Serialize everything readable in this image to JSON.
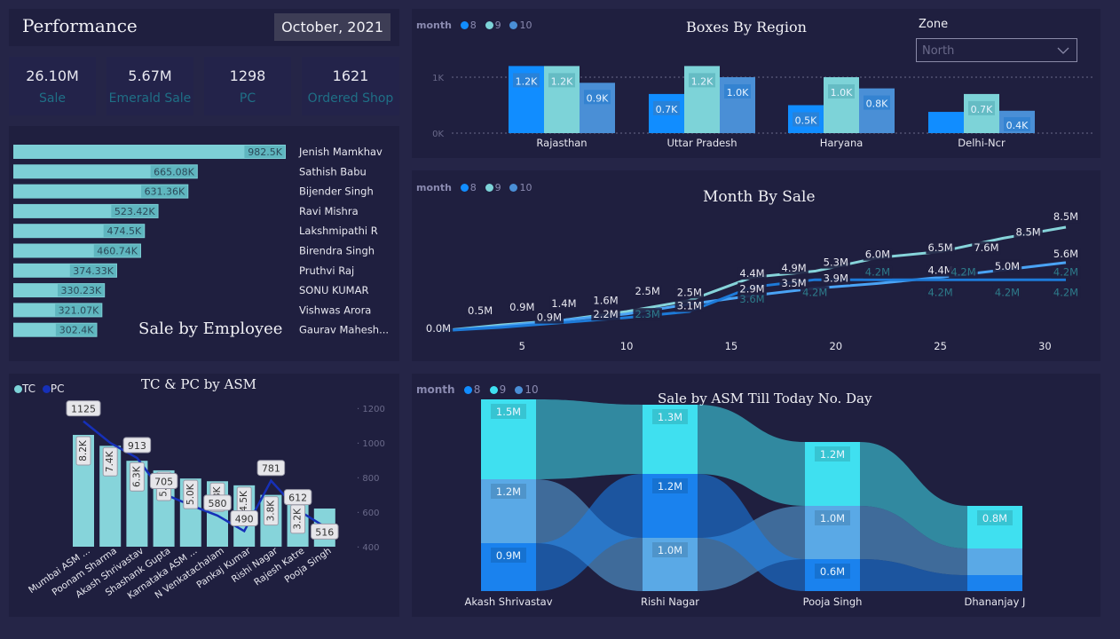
{
  "header": {
    "title": "Performance",
    "date": "October, 2021"
  },
  "kpis": [
    {
      "value": "26.10M",
      "label": "Sale"
    },
    {
      "value": "5.67M",
      "label": "Emerald Sale"
    },
    {
      "value": "1298",
      "label": "PC"
    },
    {
      "value": "1621",
      "label": "Ordered Shop"
    }
  ],
  "month_legend": {
    "label": "month",
    "items": [
      "8",
      "9",
      "10"
    ]
  },
  "zone": {
    "label": "Zone",
    "value": "North"
  },
  "colors": {
    "m8": "#118dff",
    "m9": "#7dd3d8",
    "m10": "#4a8fd6",
    "line8": "#4aa3f5",
    "line9": "#86d4da",
    "line10": "#1d7ad8"
  },
  "chart_data": [
    {
      "type": "bar",
      "title": "Sale by Employee",
      "orientation": "horizontal",
      "categories": [
        "Jenish Mamkhav",
        "Sathish Babu",
        "Bijender Singh",
        "Ravi Mishra",
        "Lakshmipathi R",
        "Birendra Singh",
        "Pruthvi Raj",
        "SONU KUMAR",
        "Vishwas Arora",
        "Gaurav Mahesh..."
      ],
      "values": [
        982500,
        665080,
        631360,
        523420,
        474500,
        460740,
        374330,
        330230,
        321070,
        302400
      ],
      "value_labels": [
        "982.5K",
        "665.08K",
        "631.36K",
        "523.42K",
        "474.5K",
        "460.74K",
        "374.33K",
        "330.23K",
        "321.07K",
        "302.4K"
      ]
    },
    {
      "type": "bar",
      "title": "Boxes By Region",
      "categories": [
        "Rajasthan",
        "Uttar Pradesh",
        "Haryana",
        "Delhi-Ncr"
      ],
      "ytick_labels": [
        "0K",
        "1K"
      ],
      "ylim": [
        0,
        1600
      ],
      "series": [
        {
          "name": "8",
          "values": [
            1200,
            700,
            500,
            380
          ],
          "labels": [
            "1.2K",
            "0.7K",
            "0.5K",
            ""
          ]
        },
        {
          "name": "9",
          "values": [
            1200,
            1200,
            1000,
            700
          ],
          "labels": [
            "1.2K",
            "1.2K",
            "1.0K",
            "0.7K"
          ]
        },
        {
          "name": "10",
          "values": [
            900,
            1000,
            800,
            400
          ],
          "labels": [
            "0.9K",
            "1.0K",
            "0.8K",
            "0.4K"
          ]
        }
      ]
    },
    {
      "type": "line",
      "title": "Month By Sale",
      "xticks": [
        5,
        10,
        15,
        20,
        25,
        30
      ],
      "xlim": [
        1,
        31
      ],
      "ylim": [
        0,
        9
      ],
      "series": [
        {
          "name": "9",
          "x": [
            1,
            4,
            7,
            10,
            13,
            16,
            19,
            22,
            25,
            28,
            31
          ],
          "values": [
            0.0,
            0.5,
            0.9,
            1.6,
            2.5,
            4.4,
            4.9,
            6.0,
            6.5,
            7.6,
            8.5
          ]
        },
        {
          "name": "8",
          "x": [
            1,
            4,
            7,
            10,
            13,
            16,
            19,
            22,
            25,
            28,
            31
          ],
          "values": [
            0.0,
            0.4,
            0.9,
            1.4,
            2.2,
            2.9,
            3.5,
            3.9,
            4.4,
            5.0,
            5.6
          ]
        },
        {
          "name": "10",
          "x": [
            1,
            4,
            7,
            10,
            13,
            16,
            19,
            22,
            25,
            28,
            31
          ],
          "values": [
            0.0,
            0.3,
            0.7,
            1.1,
            1.6,
            3.6,
            4.2,
            4.2,
            4.2,
            4.2,
            4.2
          ]
        }
      ],
      "data_labels": [
        {
          "text": "0.0M",
          "x": 1,
          "y": 0.0,
          "color": "#e8e8f0"
        },
        {
          "text": "0.5M",
          "x": 3,
          "y": 1.45,
          "color": "#e8e8f0"
        },
        {
          "text": "0.9M",
          "x": 5,
          "y": 1.75,
          "color": "#e8e8f0"
        },
        {
          "text": "1.4M",
          "x": 7,
          "y": 2.05,
          "color": "#e8e8f0"
        },
        {
          "text": "0.9M",
          "x": 6.3,
          "y": 0.9,
          "color": "#e8e8f0"
        },
        {
          "text": "1.6M",
          "x": 9,
          "y": 2.3,
          "color": "#e8e8f0"
        },
        {
          "text": "2.2M",
          "x": 9,
          "y": 1.15,
          "color": "#e8e8f0"
        },
        {
          "text": "2.3M",
          "x": 11,
          "y": 1.15,
          "color": "#2d7a8a"
        },
        {
          "text": "2.5M",
          "x": 11,
          "y": 3.05,
          "color": "#e8e8f0"
        },
        {
          "text": "2.5M",
          "x": 13,
          "y": 2.95,
          "color": "#e8e8f0"
        },
        {
          "text": "3.1M",
          "x": 13,
          "y": 1.85,
          "color": "#e8e8f0"
        },
        {
          "text": "4.4M",
          "x": 16,
          "y": 4.5,
          "color": "#e8e8f0"
        },
        {
          "text": "2.9M",
          "x": 16,
          "y": 3.25,
          "color": "#e8e8f0"
        },
        {
          "text": "3.6M",
          "x": 16,
          "y": 2.4,
          "color": "#2d7a8a"
        },
        {
          "text": "4.9M",
          "x": 18,
          "y": 4.95,
          "color": "#e8e8f0"
        },
        {
          "text": "3.5M",
          "x": 18,
          "y": 3.7,
          "color": "#e8e8f0"
        },
        {
          "text": "4.2M",
          "x": 19,
          "y": 2.95,
          "color": "#2d7a8a"
        },
        {
          "text": "5.3M",
          "x": 20,
          "y": 5.4,
          "color": "#e8e8f0"
        },
        {
          "text": "3.9M",
          "x": 20,
          "y": 4.1,
          "color": "#e8e8f0"
        },
        {
          "text": "6.0M",
          "x": 22,
          "y": 6.05,
          "color": "#e8e8f0"
        },
        {
          "text": "4.2M",
          "x": 22,
          "y": 4.6,
          "color": "#2d7a8a"
        },
        {
          "text": "6.5M",
          "x": 25,
          "y": 6.6,
          "color": "#e8e8f0"
        },
        {
          "text": "4.4M",
          "x": 25,
          "y": 4.75,
          "color": "#e8e8f0"
        },
        {
          "text": "4.2M",
          "x": 25,
          "y": 2.95,
          "color": "#2d7a8a"
        },
        {
          "text": "4.2M",
          "x": 26.1,
          "y": 4.6,
          "color": "#2d7a8a"
        },
        {
          "text": "7.6M",
          "x": 27.2,
          "y": 6.6,
          "color": "#e8e8f0"
        },
        {
          "text": "5.0M",
          "x": 28.2,
          "y": 5.1,
          "color": "#e8e8f0"
        },
        {
          "text": "4.2M",
          "x": 28.2,
          "y": 2.95,
          "color": "#2d7a8a"
        },
        {
          "text": "8.5M",
          "x": 29.2,
          "y": 7.9,
          "color": "#e8e8f0"
        },
        {
          "text": "8.5M",
          "x": 31,
          "y": 9.15,
          "color": "#e8e8f0"
        },
        {
          "text": "5.6M",
          "x": 31,
          "y": 6.1,
          "color": "#e8e8f0"
        },
        {
          "text": "4.2M",
          "x": 31,
          "y": 4.6,
          "color": "#2d7a8a"
        },
        {
          "text": "4.2M",
          "x": 31,
          "y": 2.95,
          "color": "#2d7a8a"
        }
      ]
    },
    {
      "type": "bar",
      "title": "TC & PC by ASM",
      "legend": [
        "TC",
        "PC"
      ],
      "categories": [
        "Mumbai ASM ...",
        "Poonam Sharma",
        "Akash Shrivastav",
        "Shashank Gupta",
        "Karnataka ASM ...",
        "N Venkatachalam",
        "Pankaj Kumar",
        "Rishi Nagar",
        "Rajesh Katre",
        "Pooja Singh"
      ],
      "series": [
        {
          "name": "TC",
          "type": "bar",
          "values": [
            8200,
            7400,
            6300,
            5600,
            5000,
            4800,
            4500,
            3800,
            3200,
            2800
          ],
          "labels": [
            "8.2K",
            "7.4K",
            "6.3K",
            "5.6K",
            "5.0K",
            "4.8K",
            "4.5K",
            "3.8K",
            "3.2K",
            ""
          ]
        },
        {
          "name": "PC",
          "type": "line",
          "values": [
            1125,
            1000,
            913,
            705,
            640,
            580,
            490,
            781,
            612,
            516
          ],
          "labels": [
            "1125",
            "",
            "913",
            "705",
            "",
            "580",
            "490",
            "781",
            "612",
            "516"
          ]
        }
      ],
      "y2ticks": [
        400,
        600,
        800,
        1000,
        1200
      ],
      "y2lim": [
        400,
        1300
      ],
      "ylim": [
        0,
        9500
      ]
    },
    {
      "type": "area",
      "title": "Sale by ASM Till Today No. Day",
      "categories": [
        "Akash Shrivastav",
        "Rishi Nagar",
        "Pooja Singh",
        "Dhananjay J"
      ],
      "series": [
        {
          "name": "9",
          "values": [
            1.5,
            1.3,
            1.2,
            0.8
          ],
          "labels": [
            "1.5M",
            "1.3M",
            "1.2M",
            "0.8M"
          ]
        },
        {
          "name": "10",
          "values": [
            1.2,
            1.0,
            1.0,
            0.5
          ],
          "labels": [
            "1.2M",
            "1.0M",
            "1.0M",
            ""
          ]
        },
        {
          "name": "8",
          "values": [
            0.9,
            1.2,
            0.6,
            0.3
          ],
          "labels": [
            "0.9M",
            "1.2M",
            "0.6M",
            ""
          ]
        }
      ],
      "rank_order": [
        [
          "9",
          "10",
          "8"
        ],
        [
          "9",
          "8",
          "10"
        ],
        [
          "9",
          "10",
          "8"
        ],
        [
          "9",
          "10",
          "8"
        ]
      ]
    }
  ]
}
